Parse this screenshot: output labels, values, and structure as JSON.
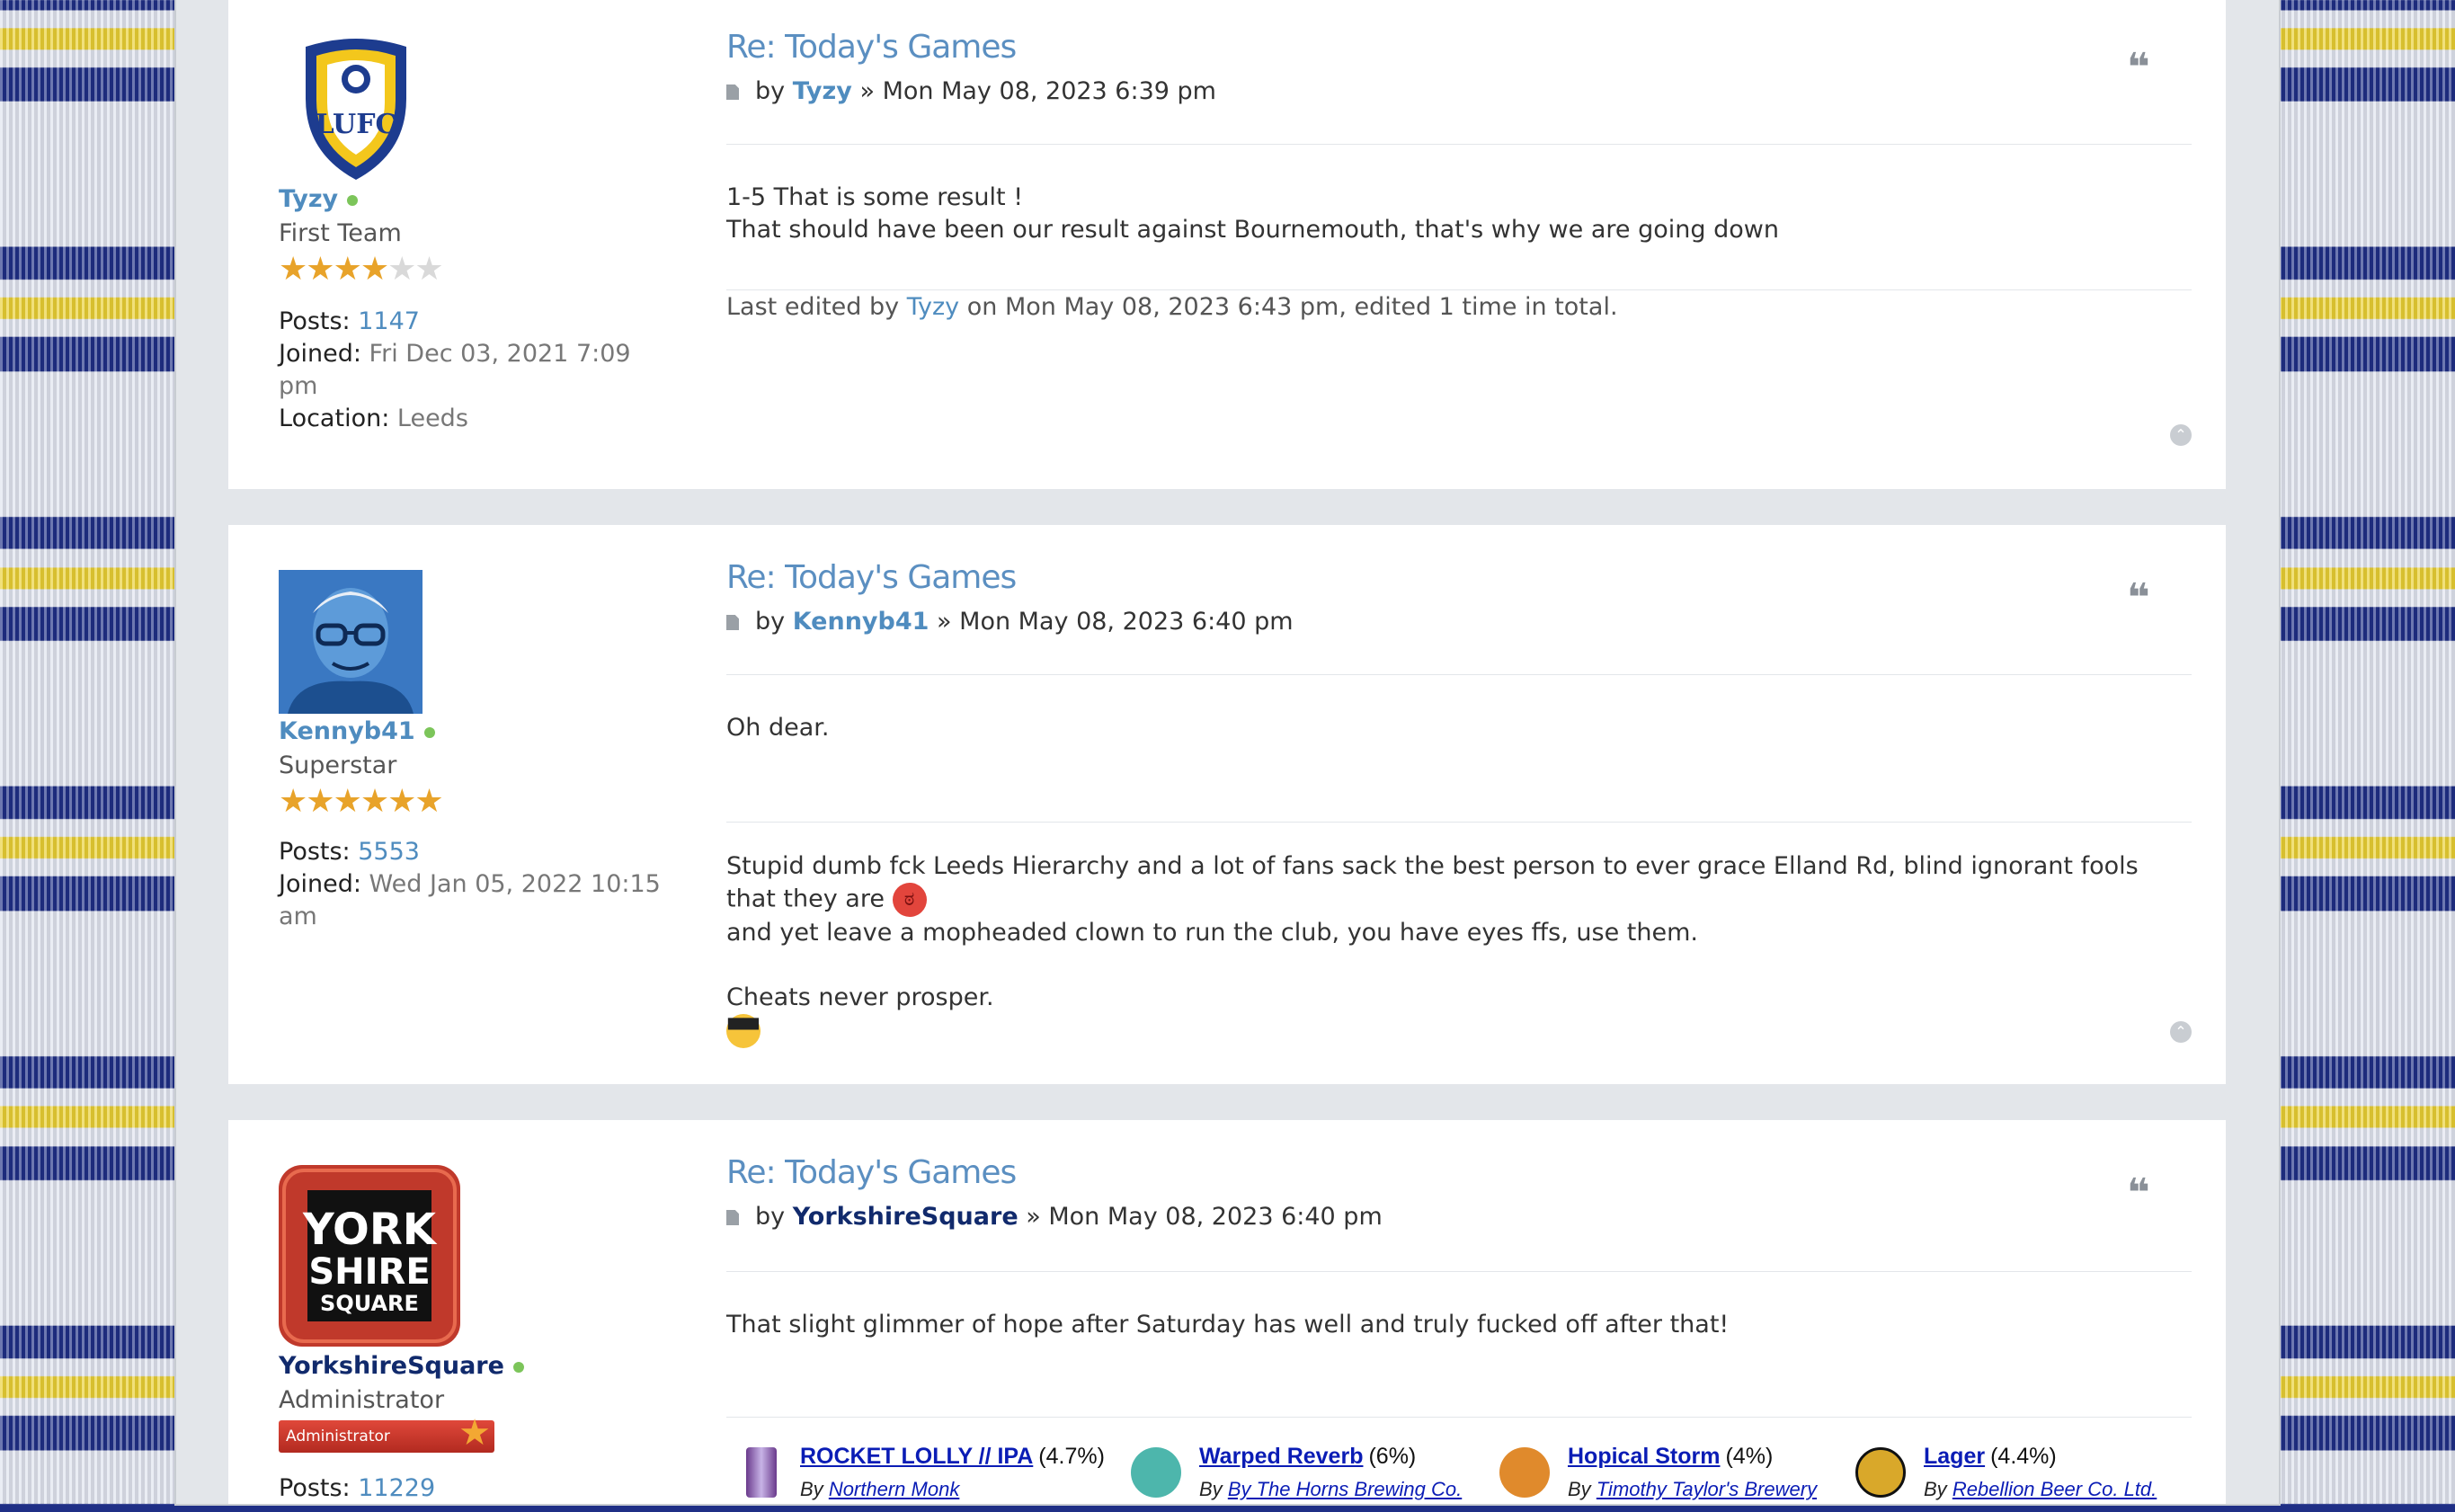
{
  "colors": {
    "accent": "#4f8cbf",
    "admin": "#112a6c",
    "online": "#7cc55a",
    "star": "#e8a32a"
  },
  "posts": [
    {
      "user": {
        "name": "Tyzy",
        "rank": "First Team",
        "stars_filled": 4,
        "stars_total": 6,
        "posts_label": "Posts:",
        "posts": "1147",
        "joined_label": "Joined:",
        "joined": "Fri Dec 03, 2021 7:09 pm",
        "location_label": "Location:",
        "location": "Leeds",
        "avatar": "leeds-crest"
      },
      "title": "Re: Today's Games",
      "by": "by",
      "author": "Tyzy",
      "sep": "»",
      "date": "Mon May 08, 2023 6:39 pm",
      "lines": [
        "1-5 That is some result !",
        "That should have been our result against Bournemouth, that's why we are going down"
      ],
      "edit": {
        "prefix": "Last edited by",
        "user": "Tyzy",
        "suffix": "on Mon May 08, 2023 6:43 pm, edited 1 time in total."
      }
    },
    {
      "user": {
        "name": "Kennyb41",
        "rank": "Superstar",
        "stars_filled": 6,
        "stars_total": 6,
        "posts_label": "Posts:",
        "posts": "5553",
        "joined_label": "Joined:",
        "joined": "Wed Jan 05, 2022 10:15 am",
        "avatar": "portrait-blue"
      },
      "title": "Re: Today's Games",
      "by": "by",
      "author": "Kennyb41",
      "sep": "»",
      "date": "Mon May 08, 2023 6:40 pm",
      "text": "Oh dear.",
      "signature": {
        "line1": "Stupid dumb fck Leeds Hierarchy and a lot of fans sack the best person to ever grace Elland Rd, blind ignorant fools that they are",
        "line2": "and yet leave a mopheaded clown to run the club, you have eyes ffs, use them.",
        "line3": "Cheats never prosper.",
        "emoji1": "angry-face-icon",
        "emoji2": "sunglasses-face-icon"
      }
    },
    {
      "user": {
        "name": "YorkshireSquare",
        "rank": "Administrator",
        "rank_badge": "Administrator",
        "posts_label": "Posts:",
        "posts": "11229",
        "avatar": "york-shire-square-logo",
        "logo_l1": "YORK",
        "logo_l2": "SHIRE",
        "logo_l3": "SQUARE"
      },
      "title": "Re: Today's Games",
      "by": "by",
      "author": "YorkshireSquare",
      "sep": "»",
      "date": "Mon May 08, 2023 6:40 pm",
      "text": "That slight glimmer of hope after Saturday has well and truly fucked off after that!",
      "beers": [
        {
          "name": "ROCKET LOLLY // IPA",
          "abv": "(4.7%)",
          "by": "By",
          "brewery": "Northern Monk"
        },
        {
          "name": "Warped Reverb",
          "abv": "(6%)",
          "by": "By",
          "brewery": "By The Horns Brewing Co."
        },
        {
          "name": "Hopical Storm",
          "abv": "(4%)",
          "by": "By",
          "brewery": "Timothy Taylor's Brewery"
        },
        {
          "name": "Lager",
          "abv": "(4.4%)",
          "by": "By",
          "brewery": "Rebellion Beer Co. Ltd."
        }
      ]
    }
  ]
}
